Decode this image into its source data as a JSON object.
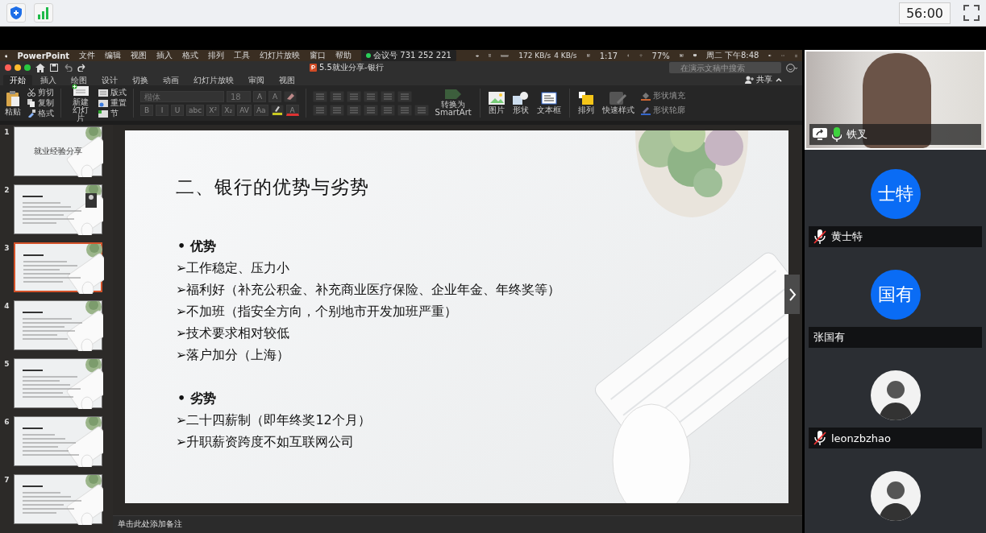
{
  "top_bar": {
    "timer": "56:00"
  },
  "menu_bar": {
    "app": "PowerPoint",
    "menus": [
      "文件",
      "编辑",
      "视图",
      "插入",
      "格式",
      "排列",
      "工具",
      "幻灯片放映",
      "窗口",
      "帮助"
    ],
    "meeting_id": "会议号 731 252 221",
    "upload_speed": "172 KB/s",
    "download_speed": "4 KB/s",
    "battery_time": "1:17",
    "battery": "77%",
    "clock": "周二 下午8:48"
  },
  "window": {
    "title": "5.5就业分享-银行",
    "search": {
      "placeholder": "在演示文稿中搜索"
    },
    "share": "共享"
  },
  "ribbon": {
    "tabs": [
      {
        "label": "开始",
        "selected": true
      },
      {
        "label": "插入",
        "selected": false
      },
      {
        "label": "绘图",
        "selected": false
      },
      {
        "label": "设计",
        "selected": false
      },
      {
        "label": "切换",
        "selected": false
      },
      {
        "label": "动画",
        "selected": false
      },
      {
        "label": "幻灯片放映",
        "selected": false
      },
      {
        "label": "审阅",
        "selected": false
      },
      {
        "label": "视图",
        "selected": false
      }
    ],
    "paste": "粘贴",
    "clipboard": [
      "剪切",
      "复制",
      "格式"
    ],
    "new_slide": "新建幻灯片",
    "slide_tools": [
      "版式",
      "重置",
      "节"
    ],
    "font": "楷体",
    "font_size": "18",
    "size_buttons": [
      "A",
      "A"
    ],
    "format_buttons": [
      "B",
      "I",
      "U",
      "abc",
      "X²",
      "X₂",
      "AV",
      "Aa"
    ],
    "font_color": "A",
    "smartart": "转换为\nSmartArt",
    "insert_buttons": [
      "图片",
      "形状",
      "文本框"
    ],
    "arrange": "排列",
    "quick_styles": "快速样式",
    "shape_fill": "形状填充",
    "shape_outline": "形状轮廓"
  },
  "thumbnails": [
    {
      "number": "1",
      "title": "就业经验分享",
      "selected": false
    },
    {
      "number": "2",
      "selected": false
    },
    {
      "number": "3",
      "selected": true
    },
    {
      "number": "4",
      "selected": false
    },
    {
      "number": "5",
      "selected": false
    },
    {
      "number": "6",
      "selected": false
    },
    {
      "number": "7",
      "selected": false
    }
  ],
  "slide": {
    "title": "二、银行的优势与劣势",
    "sections": [
      {
        "heading": "• 优势",
        "items": [
          "➢工作稳定、压力小",
          "➢福利好（补充公积金、补充商业医疗保险、企业年金、年终奖等）",
          "➢不加班（指安全方向，个别地市开发加班严重）",
          "➢技术要求相对较低",
          "➢落户加分（上海）"
        ]
      },
      {
        "heading": "• 劣势",
        "items": [
          "➢二十四薪制（即年终奖12个月）",
          "➢升职薪资跨度不如互联网公司"
        ]
      }
    ]
  },
  "notes": {
    "placeholder": "单击此处添加备注"
  },
  "participants": [
    {
      "kind": "video",
      "name": "铁叉",
      "muted": false,
      "sharing": true
    },
    {
      "kind": "initials",
      "initials": "士特",
      "name": "黄士特",
      "muted": true
    },
    {
      "kind": "initials",
      "initials": "国有",
      "name": "张国有"
    },
    {
      "kind": "photo",
      "name": "leonzbzhao",
      "muted": true
    },
    {
      "kind": "photo"
    }
  ]
}
